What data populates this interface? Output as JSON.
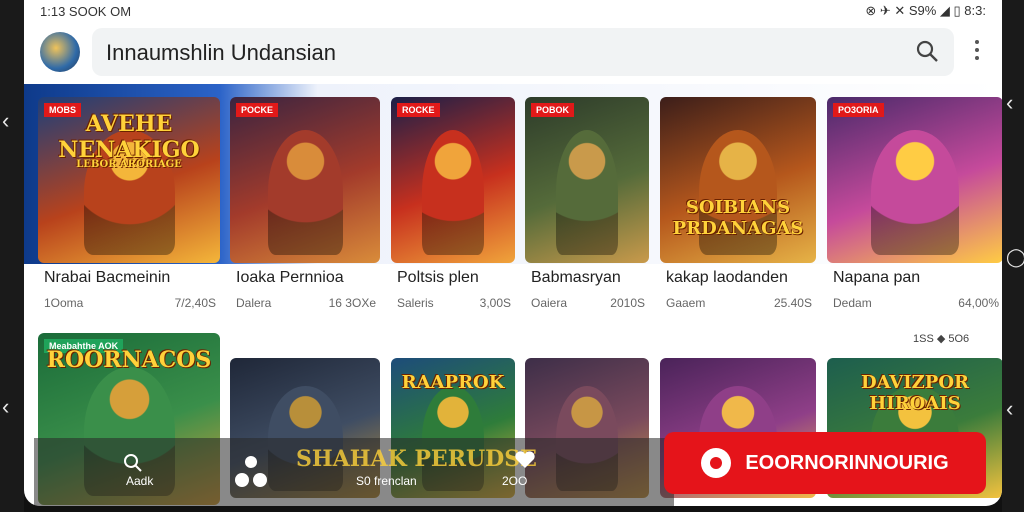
{
  "status": {
    "time": "1:13 SOOK OM",
    "icons_right": "⊗ ✈ ✕ S9% ◢ ▯ 8:3:"
  },
  "search": {
    "query": "Innaumshlin Undansian"
  },
  "colors": {
    "accent": "#e5141a",
    "banner": "#2b63c8",
    "tag": "#e11919",
    "green": "#1fa35a"
  },
  "row1": [
    {
      "tag": "MOBS",
      "art": "AVEHE NENAKIGO",
      "art_sub": "LEBOR ARORIAGE",
      "title": "Nrabai Bacmeinin",
      "a": "1Ooma",
      "b": "7/2,40S"
    },
    {
      "tag": "POCKE",
      "art": "",
      "art_sub": "",
      "title": "Ioaka Pernnioa",
      "a": "Dalera",
      "b": "16 3OXe"
    },
    {
      "tag": "ROCKE",
      "art": "",
      "art_sub": "",
      "title": "Poltsis plen",
      "a": "Saleris",
      "b": "3,00S"
    },
    {
      "tag": "POBOK",
      "art": "",
      "art_sub": "",
      "title": "Babmasryan",
      "a": "Oaiera",
      "b": "2010S"
    },
    {
      "tag": "",
      "art": "SOIBIANS PRDANAGAS",
      "art_sub": "",
      "title": "kakap laodanden",
      "a": "Gaaem",
      "b": "25.40S"
    },
    {
      "tag": "PO3ORIA",
      "art": "",
      "art_sub": "",
      "title": "Napana pan",
      "a": "Dedam",
      "b": "64,00%"
    }
  ],
  "right_label": "1SS ◆ 5O6",
  "row2": [
    {
      "tag": "Meabahthe AOK",
      "art": "ROORNACOS",
      "art_sub": ""
    },
    {
      "tag": "",
      "art": "",
      "art_sub": ""
    },
    {
      "tag": "",
      "art": "RAAPROK",
      "art_sub": ""
    },
    {
      "tag": "",
      "art": "",
      "art_sub": ""
    },
    {
      "tag": "",
      "art": "",
      "art_sub": ""
    },
    {
      "tag": "",
      "art": "DAVIZPOR HIROAIS",
      "art_sub": ""
    }
  ],
  "overlay": {
    "left_label": "Aadk",
    "art_text": "SHAHAK PERUDSE",
    "center_label": "S0 frenclan",
    "right_label": "2OO"
  },
  "install": {
    "label": "EOORNORINNOURIG"
  }
}
